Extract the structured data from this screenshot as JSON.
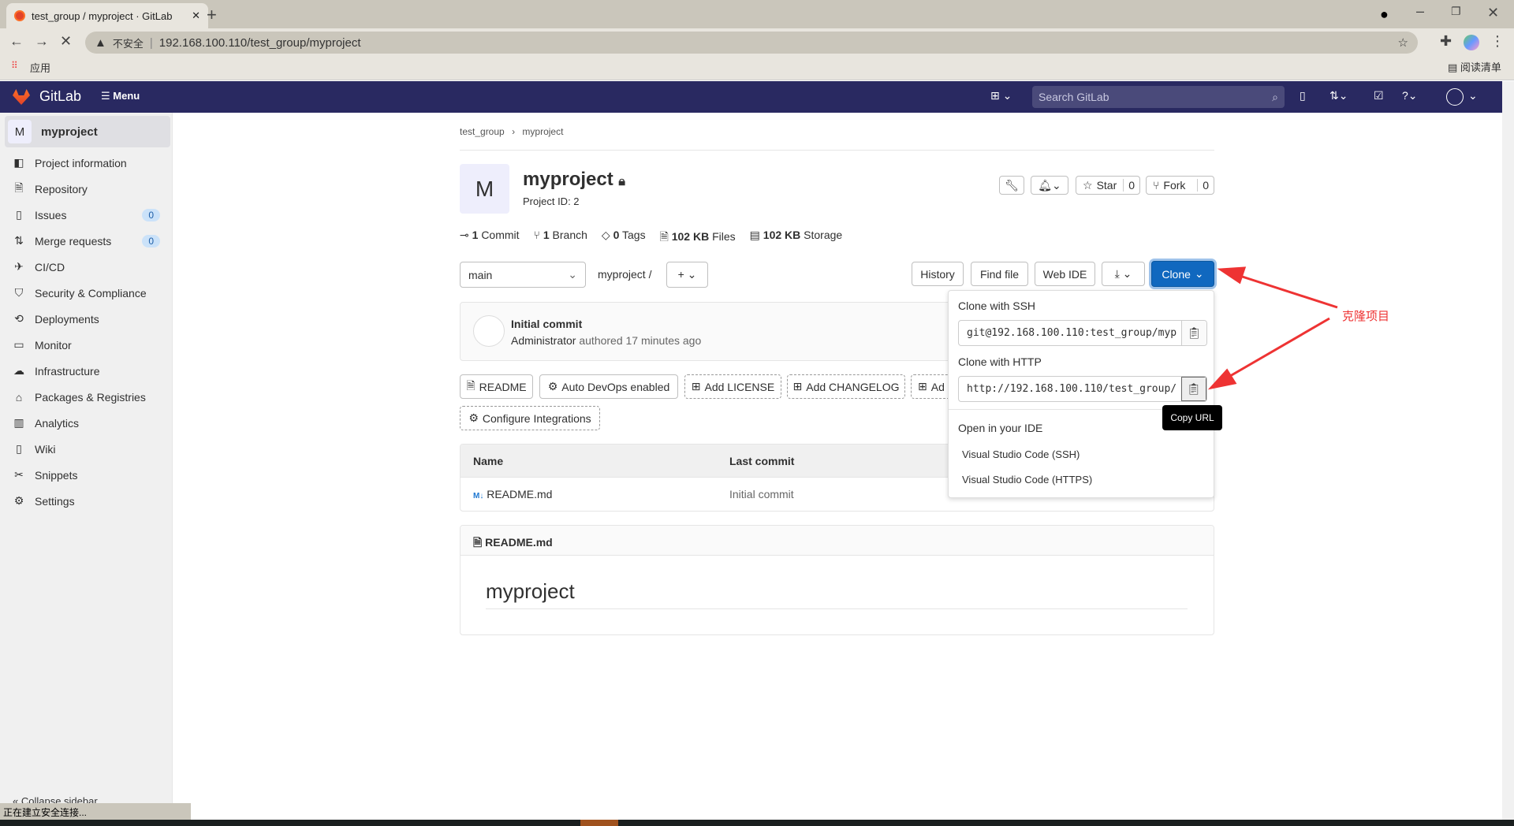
{
  "browser": {
    "tab_title": "test_group / myproject · GitLab",
    "security": "不安全",
    "url": "192.168.100.110/test_group/myproject",
    "bookmark_apps": "应用",
    "reading_list": "阅读清单",
    "status": "正在建立安全连接..."
  },
  "nav": {
    "logo": "GitLab",
    "menu": "Menu",
    "search_placeholder": "Search GitLab"
  },
  "sidebar": {
    "project_avatar": "M",
    "project_name": "myproject",
    "items": [
      {
        "label": "Project information",
        "icon": "info-icon"
      },
      {
        "label": "Repository",
        "icon": "doc-icon"
      },
      {
        "label": "Issues",
        "icon": "issues-icon",
        "badge": "0"
      },
      {
        "label": "Merge requests",
        "icon": "merge-icon",
        "badge": "0"
      },
      {
        "label": "CI/CD",
        "icon": "rocket-icon"
      },
      {
        "label": "Security & Compliance",
        "icon": "shield-icon"
      },
      {
        "label": "Deployments",
        "icon": "deploy-icon"
      },
      {
        "label": "Monitor",
        "icon": "monitor-icon"
      },
      {
        "label": "Infrastructure",
        "icon": "cloud-icon"
      },
      {
        "label": "Packages & Registries",
        "icon": "package-icon"
      },
      {
        "label": "Analytics",
        "icon": "chart-icon"
      },
      {
        "label": "Wiki",
        "icon": "book-icon"
      },
      {
        "label": "Snippets",
        "icon": "scissors-icon"
      },
      {
        "label": "Settings",
        "icon": "gear-icon"
      }
    ],
    "collapse": "Collapse sidebar"
  },
  "breadcrumb": [
    "test_group",
    "myproject"
  ],
  "project": {
    "avatar": "M",
    "name": "myproject",
    "id_label": "Project ID: 2",
    "star": "Star",
    "star_count": "0",
    "fork": "Fork",
    "fork_count": "0"
  },
  "stats": [
    {
      "n": "1",
      "label": "Commit"
    },
    {
      "n": "1",
      "label": "Branch"
    },
    {
      "n": "0",
      "label": "Tags"
    },
    {
      "n": "102 KB",
      "label": "Files"
    },
    {
      "n": "102 KB",
      "label": "Storage"
    }
  ],
  "repo_toolbar": {
    "branch": "main",
    "path": "myproject",
    "sep": "/",
    "history": "History",
    "find_file": "Find file",
    "web_ide": "Web IDE",
    "clone": "Clone"
  },
  "commit": {
    "title": "Initial commit",
    "author": "Administrator",
    "meta": "authored 17 minutes ago"
  },
  "actions": [
    "README",
    "Auto DevOps enabled",
    "Add LICENSE",
    "Add CHANGELOG",
    "Ad",
    "Configure Integrations"
  ],
  "table": {
    "headers": [
      "Name",
      "Last commit"
    ],
    "rows": [
      {
        "name": "README.md",
        "commit": "Initial commit"
      }
    ]
  },
  "readme": {
    "file": "README.md",
    "heading": "myproject"
  },
  "clone_menu": {
    "ssh_label": "Clone with SSH",
    "ssh_url": "git@192.168.100.110:test_group/myp",
    "http_label": "Clone with HTTP",
    "http_url": "http://192.168.100.110/test_group/",
    "ide_label": "Open in your IDE",
    "ide_ssh": "Visual Studio Code (SSH)",
    "ide_https": "Visual Studio Code (HTTPS)",
    "tooltip": "Copy URL"
  },
  "annotation": {
    "text": "克隆项目",
    "color": "#ee3333"
  },
  "colors": {
    "nav": "#292961",
    "primary": "#1068bf"
  }
}
